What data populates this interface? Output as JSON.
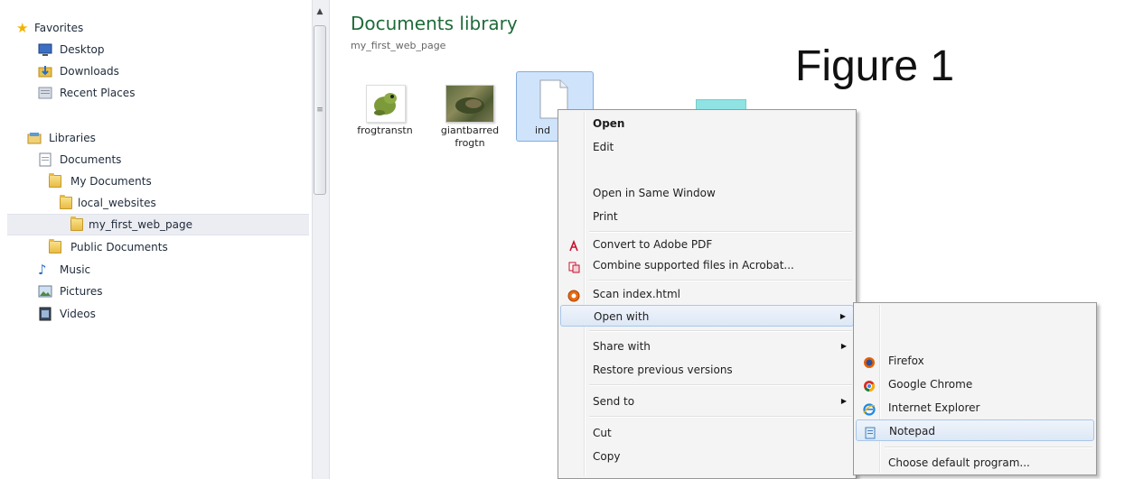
{
  "nav": {
    "favorites": "Favorites",
    "desktop": "Desktop",
    "downloads": "Downloads",
    "recent_places": "Recent Places",
    "libraries": "Libraries",
    "documents": "Documents",
    "my_documents": "My Documents",
    "local_websites": "local_websites",
    "my_first_web_page": "my_first_web_page",
    "public_documents": "Public Documents",
    "music": "Music",
    "pictures": "Pictures",
    "videos": "Videos"
  },
  "content": {
    "title": "Documents library",
    "subtitle": "my_first_web_page",
    "figure_label": "Figure 1",
    "files": [
      {
        "name": "frogtranstn"
      },
      {
        "name": "giantbarred frogtn"
      },
      {
        "name": "ind"
      }
    ]
  },
  "context_menu": {
    "open": "Open",
    "edit": "Edit",
    "open_same_window": "Open in Same Window",
    "print": "Print",
    "convert_pdf": "Convert to Adobe PDF",
    "combine_acrobat": "Combine supported files in Acrobat...",
    "scan": "Scan index.html",
    "open_with": "Open with",
    "share_with": "Share with",
    "restore": "Restore previous versions",
    "send_to": "Send to",
    "cut": "Cut",
    "copy": "Copy"
  },
  "open_with_menu": {
    "firefox": "Firefox",
    "chrome": "Google Chrome",
    "ie": "Internet Explorer",
    "notepad": "Notepad",
    "choose_default": "Choose default program..."
  },
  "icons": {
    "favorites": "star-icon",
    "desktop": "desktop-icon",
    "downloads": "downloads-icon",
    "recent_places": "recent-places-icon",
    "libraries": "libraries-icon",
    "documents": "documents-icon",
    "folder": "folder-icon",
    "music": "music-icon",
    "pictures": "pictures-icon",
    "videos": "videos-icon"
  },
  "colors": {
    "title_green": "#1f6b3a",
    "selection_blue": "#cfe3fb",
    "menu_hover": "#dde8f6"
  }
}
